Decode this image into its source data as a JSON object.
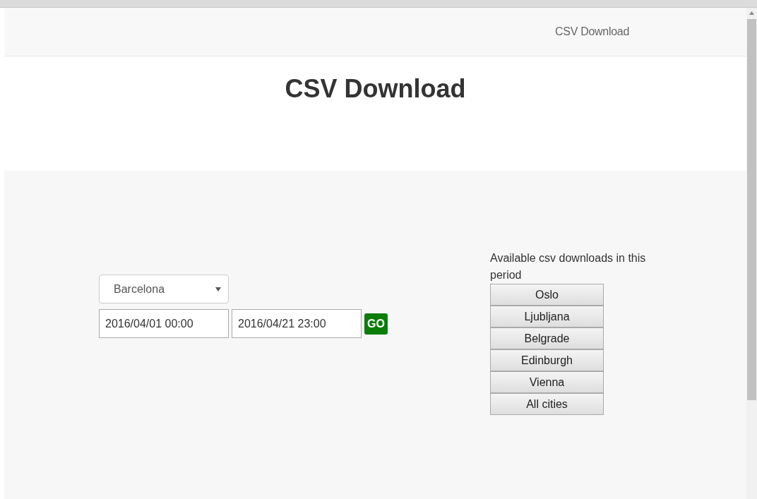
{
  "navbar": {
    "link": "CSV Download"
  },
  "heading": "CSV Download",
  "form": {
    "city_select": {
      "value": "Barcelona"
    },
    "start": {
      "value": "2016/04/01 00:00"
    },
    "end": {
      "value": "2016/04/21 23:00"
    },
    "go_button": "GO"
  },
  "downloads": {
    "title": "Available csv downloads in this period",
    "buttons": [
      "Oslo",
      "Ljubljana",
      "Belgrade",
      "Edinburgh",
      "Vienna",
      "All cities"
    ]
  }
}
